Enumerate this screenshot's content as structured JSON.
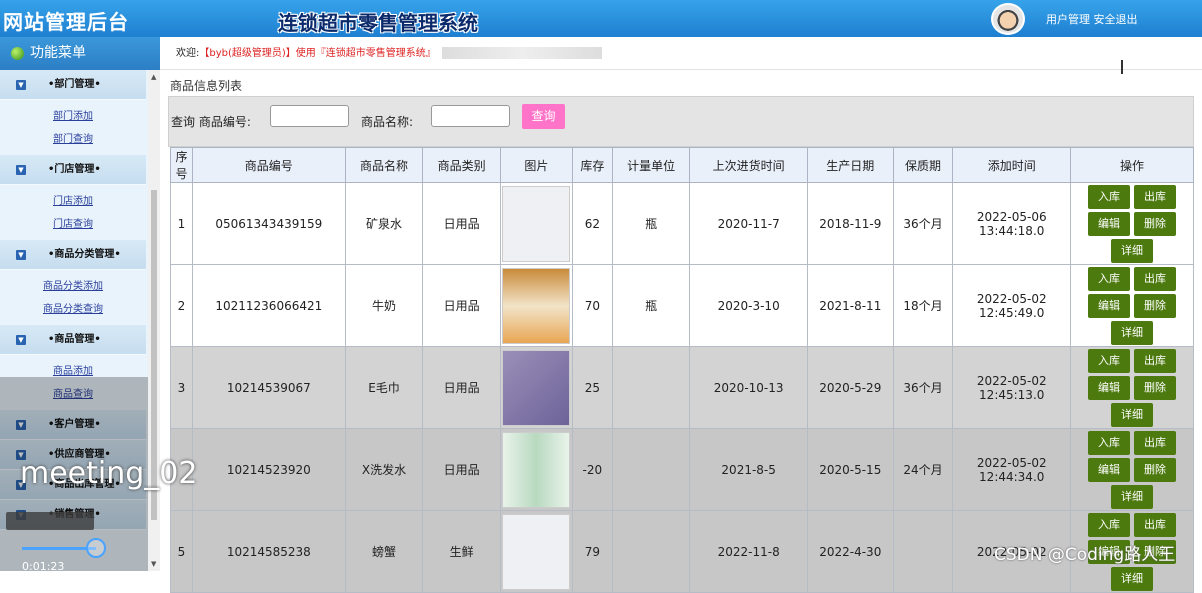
{
  "header": {
    "logo": "网站管理后台",
    "system_title": "连锁超市零售管理系统",
    "links": "用户管理 安全退出"
  },
  "sidebar": {
    "title": "功能菜单",
    "groups": [
      {
        "label": "•部门管理•",
        "items": [
          "部门添加",
          "部门查询"
        ]
      },
      {
        "label": "•门店管理•",
        "items": [
          "门店添加",
          "门店查询"
        ]
      },
      {
        "label": "•商品分类管理•",
        "items": [
          "商品分类添加",
          "商品分类查询"
        ]
      },
      {
        "label": "•商品管理•",
        "items": [
          "商品添加",
          "商品查询"
        ]
      },
      {
        "label": "•客户管理•",
        "items": []
      },
      {
        "label": "•供应商管理•",
        "items": []
      },
      {
        "label": "•商品出库管理•",
        "items": []
      },
      {
        "label": "•销售管理•",
        "items": []
      }
    ]
  },
  "welcome": {
    "prefix": "欢迎:",
    "user": "【byb(超级管理员)】",
    "mid": "使用",
    "sys": "『连锁超市零售管理系统』"
  },
  "list_title": "商品信息列表",
  "search": {
    "label_query": "查询 商品编号:",
    "label_name": "商品名称:",
    "button": "查询"
  },
  "table": {
    "headers": [
      "序号",
      "商品编号",
      "商品名称",
      "商品类别",
      "图片",
      "库存",
      "计量单位",
      "上次进货时间",
      "生产日期",
      "保质期",
      "添加时间",
      "操作"
    ],
    "rows": [
      {
        "no": "1",
        "code": "05061343439159",
        "name": "矿泉水",
        "cat": "日用品",
        "stock": "62",
        "unit": "瓶",
        "last": "2020-11-7",
        "prod": "2018-11-9",
        "shelf": "36个月",
        "added1": "2022-05-06",
        "added2": "13:44:18.0"
      },
      {
        "no": "2",
        "code": "10211236066421",
        "name": "牛奶",
        "cat": "日用品",
        "stock": "70",
        "unit": "瓶",
        "last": "2020-3-10",
        "prod": "2021-8-11",
        "shelf": "18个月",
        "added1": "2022-05-02",
        "added2": "12:45:49.0"
      },
      {
        "no": "3",
        "code": "10214539067",
        "name": "E毛巾",
        "cat": "日用品",
        "stock": "25",
        "unit": "",
        "last": "2020-10-13",
        "prod": "2020-5-29",
        "shelf": "36个月",
        "added1": "2022-05-02",
        "added2": "12:45:13.0"
      },
      {
        "no": "",
        "code": "10214523920",
        "name": "X洗发水",
        "cat": "日用品",
        "stock": "-20",
        "unit": "",
        "last": "2021-8-5",
        "prod": "2020-5-15",
        "shelf": "24个月",
        "added1": "2022-05-02",
        "added2": "12:44:34.0"
      },
      {
        "no": "5",
        "code": "10214585238",
        "name": "螃蟹",
        "cat": "生鲜",
        "stock": "79",
        "unit": "",
        "last": "2022-11-8",
        "prod": "2022-4-30",
        "shelf": "",
        "added1": "2022-05-02",
        "added2": ""
      }
    ],
    "ops": [
      "入库",
      "出库",
      "编辑",
      "删除",
      "详细"
    ]
  },
  "overlay": {
    "watermark": "meeting_02",
    "time": "0:01:23",
    "csdn": "CSDN @Coding路人王"
  }
}
